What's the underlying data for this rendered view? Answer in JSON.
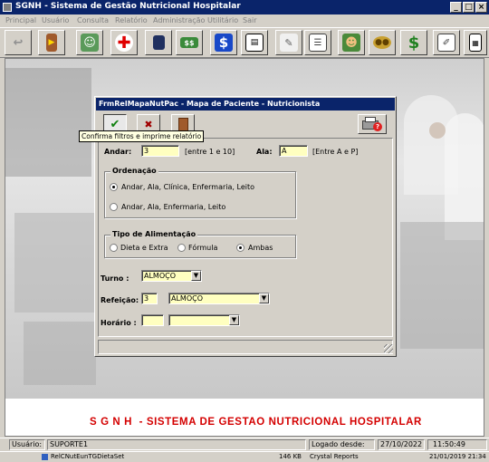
{
  "window": {
    "title": "SGNH - Sistema de Gestão Nutricional Hospitalar",
    "min_label": "_",
    "max_label": "□",
    "close_label": "×"
  },
  "menu": [
    "Principal",
    "Usuário",
    "Consulta",
    "Relatório",
    "Administração",
    "Utilitário",
    "Sair"
  ],
  "toolbar_icons": [
    "return-icon",
    "exit-door-icon",
    "nutritionist-icon",
    "red-cross-icon",
    "notebook-icon",
    "money-icon",
    "dollar-icon",
    "document-icon",
    "scroll-icon",
    "form-icon",
    "user-icon",
    "coins-icon",
    "green-dollar-icon",
    "notes-icon",
    "calculator-icon"
  ],
  "dialog": {
    "title": "FrmRelMapaNutPac - Mapa de Paciente - Nutricionista",
    "tooltip": "Confirma filtros e imprime relatório",
    "buttons": {
      "confirm": "✔",
      "cancel": "✖",
      "exit": "exit-icon",
      "print": "printer-help-icon"
    },
    "andar": {
      "label": "Andar:",
      "value": "3",
      "hint": "[entre 1 e 10]"
    },
    "ala": {
      "label": "Ala:",
      "value": "A",
      "hint": "[Entre A e P]"
    },
    "ordenacao": {
      "title": "Ordenação",
      "options": [
        "Andar, Ala, Clínica, Enfermaria, Leito",
        "Andar, Ala, Enfermaria, Leito"
      ],
      "selected": 0
    },
    "tipo_alimentacao": {
      "title": "Tipo de Alimentação",
      "options": [
        "Dieta e Extra",
        "Fórmula",
        "Ambas"
      ],
      "selected": 2
    },
    "turno": {
      "label": "Turno :",
      "value": "ALMOÇO"
    },
    "refeicao": {
      "label": "Refeição:",
      "code": "3",
      "value": "ALMOÇO"
    },
    "horario": {
      "label": "Horário :",
      "code": "",
      "value": ""
    }
  },
  "banner": "S G N H  - SISTEMA DE GESTAO NUTRICIONAL HOSPITALAR",
  "status": {
    "usuario_label": "Usuário:",
    "usuario": "SUPORTE1",
    "logado_label": "Logado desde:",
    "date": "27/10/2022",
    "time": "11:50:49"
  },
  "taskbar": {
    "file": "RelCNutEunTGDietaSet",
    "size": "146 KB",
    "type": "Crystal Reports",
    "date": "21/01/2019 21:34"
  },
  "colors": {
    "titlebar": "#0a246a",
    "field": "#ffffc0",
    "banner_text": "#d40000"
  }
}
